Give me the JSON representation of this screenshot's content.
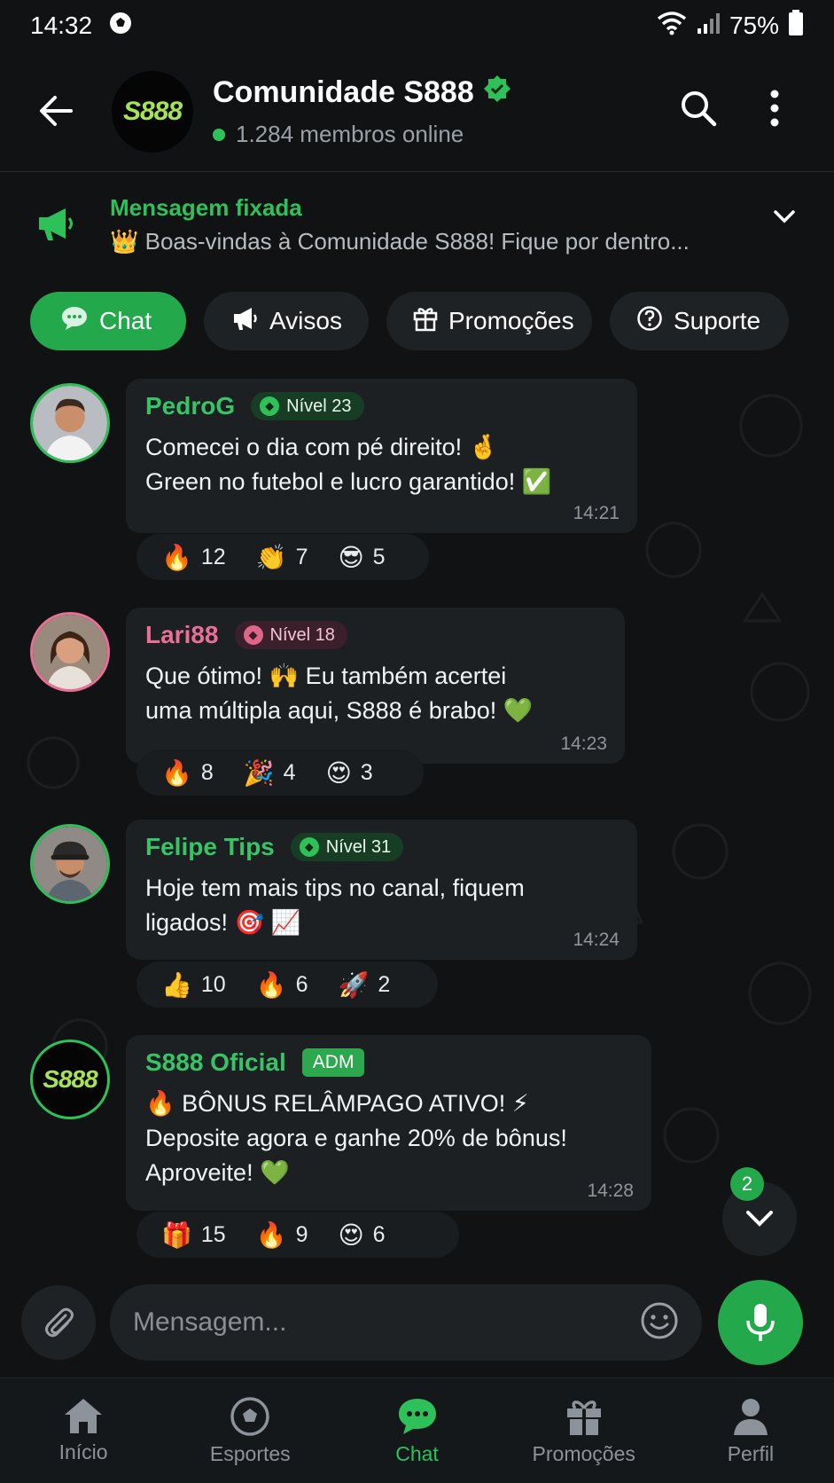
{
  "status_bar": {
    "time": "14:32",
    "battery": "75%"
  },
  "header": {
    "logo_text": "S888",
    "title": "Comunidade S888",
    "subtitle": "1.284 membros online"
  },
  "pinned": {
    "title": "Mensagem fixada",
    "text": "👑 Boas-vindas à Comunidade S888! Fique por dentro..."
  },
  "tabs": [
    {
      "label": "Chat",
      "icon": "chat-bubble-icon"
    },
    {
      "label": "Avisos",
      "icon": "megaphone-icon"
    },
    {
      "label": "Promoções",
      "icon": "gift-icon"
    },
    {
      "label": "Suporte",
      "icon": "help-circle-icon"
    }
  ],
  "messages": [
    {
      "name": "PedroG",
      "badge": "Nível 23",
      "text": "Comecei o dia com pé direito! 🤞\nGreen no futebol e lucro garantido! ✅",
      "time": "14:21",
      "reactions": [
        {
          "emoji": "🔥",
          "count": "12"
        },
        {
          "emoji": "👏",
          "count": "7"
        },
        {
          "emoji": "😎",
          "count": "5"
        }
      ]
    },
    {
      "name": "Lari88",
      "badge": "Nível 18",
      "text": "Que ótimo! 🙌 Eu também acertei\numa múltipla aqui, S888 é brabo! 💚",
      "time": "14:23",
      "reactions": [
        {
          "emoji": "🔥",
          "count": "8"
        },
        {
          "emoji": "🎉",
          "count": "4"
        },
        {
          "emoji": "😍",
          "count": "3"
        }
      ]
    },
    {
      "name": "Felipe Tips",
      "badge": "Nível 31",
      "text": "Hoje tem mais tips no canal, fiquem\nligados! 🎯 📈",
      "time": "14:24",
      "reactions": [
        {
          "emoji": "👍",
          "count": "10"
        },
        {
          "emoji": "🔥",
          "count": "6"
        },
        {
          "emoji": "🚀",
          "count": "2"
        }
      ]
    },
    {
      "name": "S888 Oficial",
      "badge": "ADM",
      "logo_text": "S888",
      "text": "🔥 BÔNUS RELÂMPAGO ATIVO! ⚡\nDeposite agora e ganhe 20% de bônus!\nAproveite! 💚",
      "time": "14:28",
      "reactions": [
        {
          "emoji": "🎁",
          "count": "15"
        },
        {
          "emoji": "🔥",
          "count": "9"
        },
        {
          "emoji": "😍",
          "count": "6"
        }
      ]
    }
  ],
  "scroll_badge": "2",
  "composer": {
    "placeholder": "Mensagem..."
  },
  "bottom_nav": [
    {
      "label": "Início",
      "icon": "home-icon"
    },
    {
      "label": "Esportes",
      "icon": "soccer-ball-icon"
    },
    {
      "label": "Chat",
      "icon": "chat-bubble-icon"
    },
    {
      "label": "Promoções",
      "icon": "gift-icon"
    },
    {
      "label": "Perfil",
      "icon": "person-icon"
    }
  ],
  "colors": {
    "accent": "#23a94b",
    "name_green": "#37c466",
    "name_pink": "#e96f97",
    "background": "#101214",
    "bubble": "#1d2023"
  }
}
